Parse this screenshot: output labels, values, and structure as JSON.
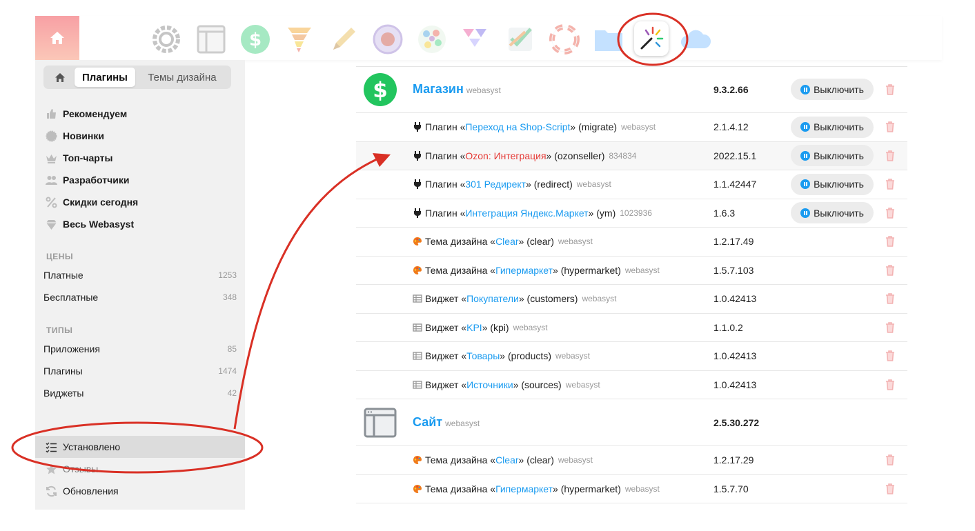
{
  "colors": {
    "accent": "#1a9bf0",
    "annotation": "#d93025",
    "danger": "#e53935"
  },
  "appbar": {
    "icons": [
      "home-icon",
      "settings-gear-icon",
      "site-window-icon",
      "shop-dollar-icon",
      "tornado-icon",
      "pencil-icon",
      "camera-lens-icon",
      "mosaic-icon",
      "triangles-icon",
      "checklist-icon",
      "lifebuoy-icon",
      "folder-icon",
      "installer-wand-icon",
      "cloud-icon"
    ]
  },
  "sidebar": {
    "tabs": {
      "active": "Плагины",
      "third": "Темы дизайна"
    },
    "nav": [
      {
        "label": "Рекомендуем",
        "icon": "thumbs-up-icon"
      },
      {
        "label": "Новинки",
        "icon": "badge-icon"
      },
      {
        "label": "Топ-чарты",
        "icon": "crown-icon"
      },
      {
        "label": "Разработчики",
        "icon": "users-icon"
      },
      {
        "label": "Скидки сегодня",
        "icon": "percent-icon"
      },
      {
        "label": "Весь Webasyst",
        "icon": "diamond-icon"
      }
    ],
    "prices": {
      "heading": "ЦЕНЫ",
      "items": [
        {
          "label": "Платные",
          "count": "1253"
        },
        {
          "label": "Бесплатные",
          "count": "348"
        }
      ]
    },
    "types": {
      "heading": "ТИПЫ",
      "items": [
        {
          "label": "Приложения",
          "count": "85"
        },
        {
          "label": "Плагины",
          "count": "1474"
        },
        {
          "label": "Виджеты",
          "count": "42"
        }
      ]
    },
    "bottom": [
      {
        "label": "Установлено",
        "icon": "list-check-icon"
      },
      {
        "label": "Отзывы",
        "icon": "star-icon"
      },
      {
        "label": "Обновления",
        "icon": "refresh-icon"
      }
    ]
  },
  "list": {
    "disable_label": "Выключить",
    "shop": {
      "name": "Магазин",
      "vendor": "webasyst",
      "version": "9.3.2.66",
      "items": [
        {
          "kind": "plugin",
          "prefix": "Плагин «",
          "link": "Переход на Shop-Script",
          "suffix": "» (migrate)",
          "vendor": "webasyst",
          "version": "2.1.4.12"
        },
        {
          "kind": "plugin",
          "prefix": "Плагин «",
          "link": "Ozon: Интеграция",
          "suffix": "» (ozonseller)",
          "vendor": "834834",
          "version": "2022.15.1"
        },
        {
          "kind": "plugin",
          "prefix": "Плагин «",
          "link": "301 Редирект",
          "suffix": "» (redirect)",
          "vendor": "webasyst",
          "version": "1.1.42447"
        },
        {
          "kind": "plugin",
          "prefix": "Плагин «",
          "link": "Интеграция Яндекс.Маркет",
          "suffix": "» (ym)",
          "vendor": "1023936",
          "version": "1.6.3"
        },
        {
          "kind": "theme",
          "prefix": "Тема дизайна «",
          "link": "Clear",
          "suffix": "» (clear)",
          "vendor": "webasyst",
          "version": "1.2.17.49"
        },
        {
          "kind": "theme",
          "prefix": "Тема дизайна «",
          "link": "Гипермаркет",
          "suffix": "» (hypermarket)",
          "vendor": "webasyst",
          "version": "1.5.7.103"
        },
        {
          "kind": "widget",
          "prefix": "Виджет «",
          "link": "Покупатели",
          "suffix": "» (customers)",
          "vendor": "webasyst",
          "version": "1.0.42413"
        },
        {
          "kind": "widget",
          "prefix": "Виджет «",
          "link": "KPI",
          "suffix": "» (kpi)",
          "vendor": "webasyst",
          "version": "1.1.0.2"
        },
        {
          "kind": "widget",
          "prefix": "Виджет «",
          "link": "Товары",
          "suffix": "» (products)",
          "vendor": "webasyst",
          "version": "1.0.42413"
        },
        {
          "kind": "widget",
          "prefix": "Виджет «",
          "link": "Источники",
          "suffix": "» (sources)",
          "vendor": "webasyst",
          "version": "1.0.42413"
        }
      ]
    },
    "site": {
      "name": "Сайт",
      "vendor": "webasyst",
      "version": "2.5.30.272",
      "items": [
        {
          "kind": "theme",
          "prefix": "Тема дизайна «",
          "link": "Clear",
          "suffix": "» (clear)",
          "vendor": "webasyst",
          "version": "1.2.17.29"
        },
        {
          "kind": "theme",
          "prefix": "Тема дизайна «",
          "link": "Гипермаркет",
          "suffix": "» (hypermarket)",
          "vendor": "webasyst",
          "version": "1.5.7.70"
        }
      ]
    }
  }
}
